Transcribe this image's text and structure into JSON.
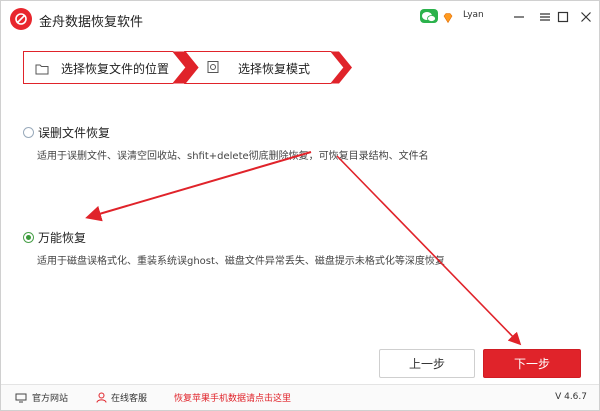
{
  "titlebar": {
    "app_title": "金舟数据恢复软件",
    "username": "Lyan",
    "minimize_label": "—",
    "maximize_label": "□",
    "close_label": "✕"
  },
  "steps": [
    {
      "label": "选择恢复文件的位置",
      "icon": "folder-icon"
    },
    {
      "label": "选择恢复模式",
      "icon": "restore-icon"
    }
  ],
  "options": [
    {
      "title": "误删文件恢复",
      "desc": "适用于误删文件、误清空回收站、shfit+delete彻底删除恢复，可恢复目录结构、文件名",
      "checked": false
    },
    {
      "title": "万能恢复",
      "desc": "适用于磁盘误格式化、重装系统误ghost、磁盘文件异常丢失、磁盘提示未格式化等深度恢复",
      "checked": true
    }
  ],
  "buttons": {
    "prev": "上一步",
    "next": "下一步"
  },
  "footer": {
    "website": "官方网站",
    "service": "在线客服",
    "promo_link": "恢复苹果手机数据请点击这里",
    "version": "V 4.6.7"
  },
  "colors": {
    "accent": "#e0232a",
    "wechat": "#2bb24c",
    "radio_checked": "#3a9a3a"
  }
}
